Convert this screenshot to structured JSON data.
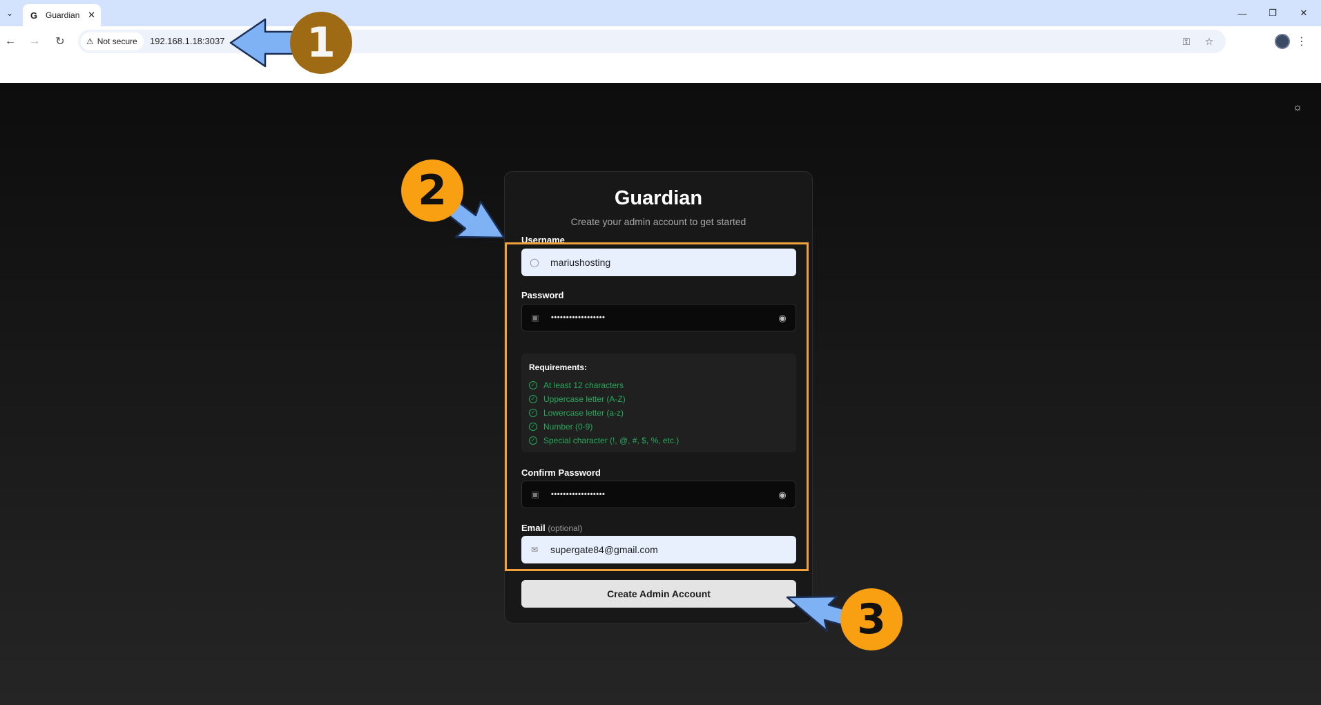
{
  "browser": {
    "tab_title": "Guardian",
    "favicon_letter": "G",
    "security_label": "Not secure",
    "url": "192.168.1.18:3037"
  },
  "form": {
    "title": "Guardian",
    "subtitle": "Create your admin account to get started",
    "username_label": "Username",
    "username_value": "mariushosting",
    "password_label": "Password",
    "password_value": "••••••••••••••••••",
    "requirements_title": "Requirements:",
    "requirements": [
      "At least 12 characters",
      "Uppercase letter (A-Z)",
      "Lowercase letter (a-z)",
      "Number (0-9)",
      "Special character (!, @, #, $, %, etc.)"
    ],
    "confirm_label": "Confirm Password",
    "confirm_value": "••••••••••••••••••",
    "email_label": "Email",
    "email_optional": "(optional)",
    "email_value": "supergate84@gmail.com",
    "submit_label": "Create Admin Account"
  },
  "annotations": {
    "badge_1": "1",
    "badge_2": "2",
    "badge_3": "3",
    "colors": {
      "highlight": "#f2a23c",
      "arrow": "#7fb2f5",
      "badge_orange": "#f99f12",
      "badge_brown": "#9e6a14"
    }
  },
  "icons": [
    "tab-search-icon",
    "close-icon",
    "minimize-icon",
    "restore-icon",
    "back-icon",
    "forward-icon",
    "reload-icon",
    "warning-icon",
    "password-key-icon",
    "star-icon",
    "menu-icon",
    "sun-icon",
    "user-icon",
    "lock-icon",
    "eye-icon",
    "mail-icon",
    "check-circle-icon"
  ]
}
